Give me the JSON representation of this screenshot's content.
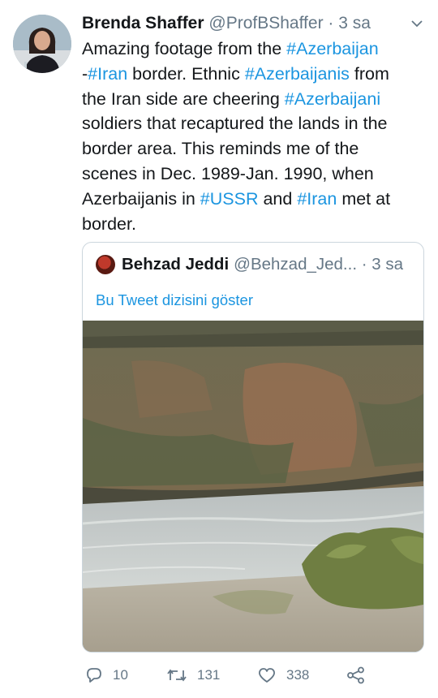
{
  "tweet": {
    "author_name": "Brenda Shaffer",
    "author_handle": "@ProfBShaffer",
    "separator": "·",
    "time": "3 sa",
    "text_parts": [
      {
        "t": "Amazing footage from the ",
        "h": false
      },
      {
        "t": "#Azerbaijan",
        "h": true
      },
      {
        "t": "\n-",
        "h": false
      },
      {
        "t": "#Iran",
        "h": true
      },
      {
        "t": " border. Ethnic ",
        "h": false
      },
      {
        "t": "#Azerbaijanis",
        "h": true
      },
      {
        "t": " from\nthe Iran side are cheering ",
        "h": false
      },
      {
        "t": "#Azerbaijani",
        "h": true
      },
      {
        "t": "\nsoldiers that  recaptured the lands in the\nborder area. This reminds me of the\nscenes in Dec. 1989-Jan. 1990, when\nAzerbaijanis in ",
        "h": false
      },
      {
        "t": "#USSR",
        "h": true
      },
      {
        "t": " and ",
        "h": false
      },
      {
        "t": "#Iran",
        "h": true
      },
      {
        "t": " met at\nborder.",
        "h": false
      }
    ]
  },
  "quote": {
    "author_name": "Behzad Jeddi",
    "author_handle": "@Behzad_Jed...",
    "separator": "·",
    "time": "3 sa",
    "thread_link": "Bu Tweet dizisini göster"
  },
  "actions": {
    "reply_count": "10",
    "retweet_count": "131",
    "like_count": "338"
  },
  "icons": [
    "chevron-down-icon",
    "reply-icon",
    "retweet-icon",
    "like-icon",
    "share-icon"
  ],
  "colors": {
    "link": "#1b95e0",
    "muted": "#657786",
    "text": "#14171a",
    "border": "#ccd6dd"
  }
}
